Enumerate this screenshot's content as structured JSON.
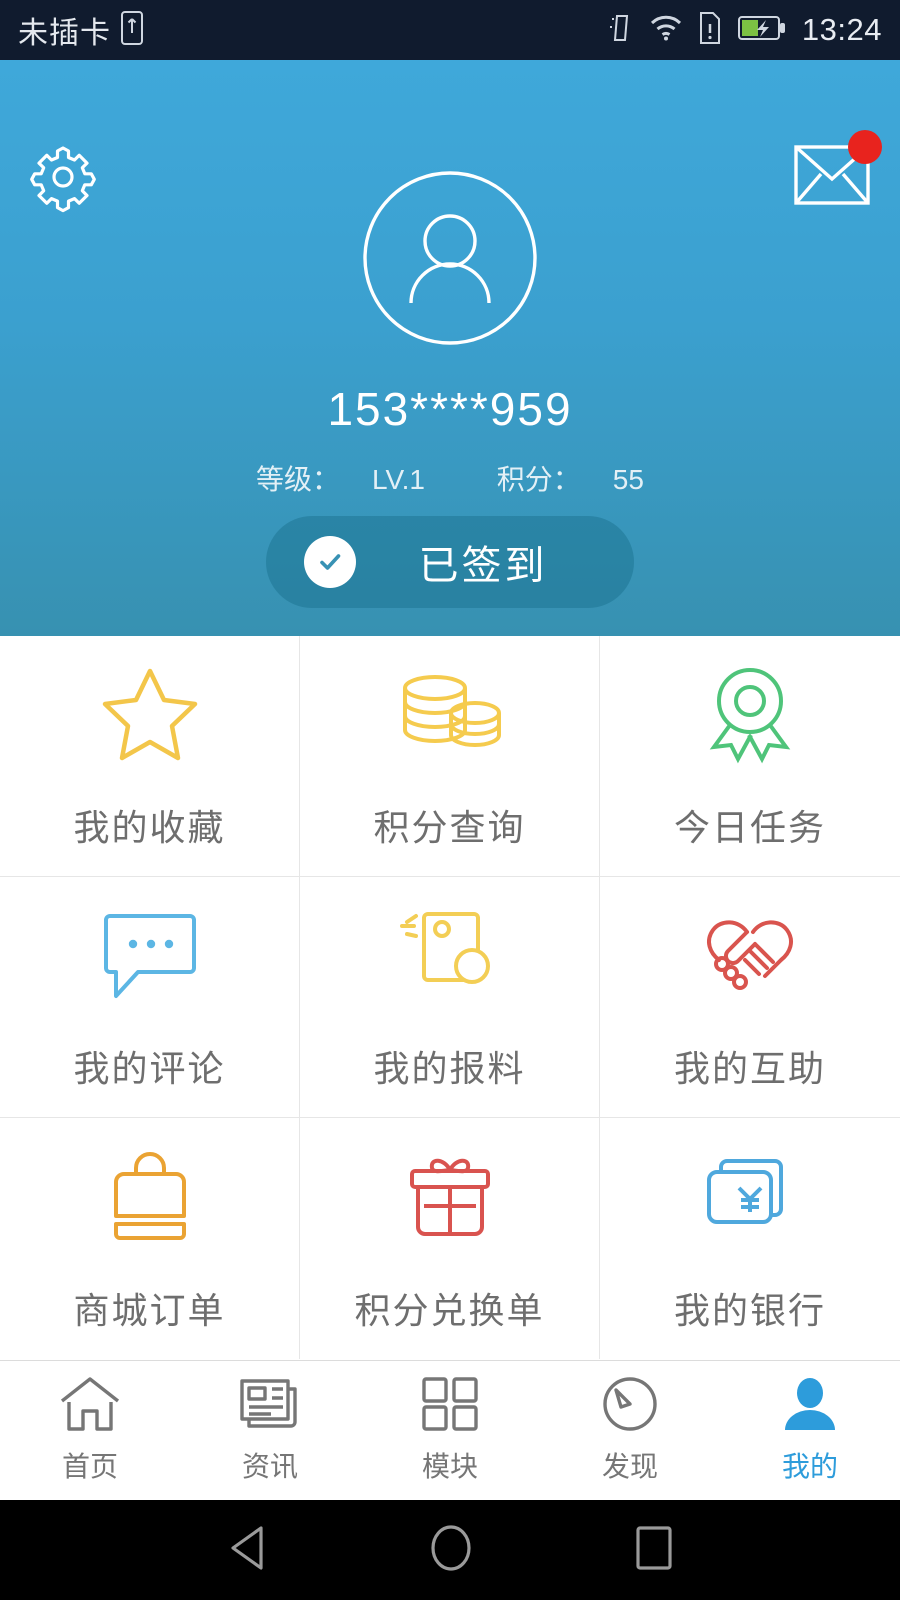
{
  "statusbar": {
    "carrier": "未插卡",
    "time": "13:24",
    "icons": [
      "sim-card-icon",
      "vibrate-icon",
      "wifi-icon",
      "sim-alert-icon",
      "battery-charging-icon"
    ]
  },
  "header": {
    "gear_icon": "gear-icon",
    "mail_icon": "envelope-icon",
    "badge_visible": true,
    "avatar_icon": "user-avatar-icon",
    "username": "153****959",
    "level_label": "等级：",
    "level_value": "LV.1",
    "points_label": "积分：",
    "points_value": "55",
    "signin_label": "已签到",
    "signin_icon": "check-circle-icon",
    "gradient_top": "#3fa8da",
    "gradient_bottom": "#3791b1"
  },
  "grid": {
    "items": [
      {
        "label": "我的收藏",
        "icon": "star-icon",
        "color": "#f3c64a"
      },
      {
        "label": "积分查询",
        "icon": "coins-icon",
        "color": "#f5cb4e"
      },
      {
        "label": "今日任务",
        "icon": "medal-icon",
        "color": "#4fc47a"
      },
      {
        "label": "我的评论",
        "icon": "comment-icon",
        "color": "#5cb6e4"
      },
      {
        "label": "我的报料",
        "icon": "tipoff-icon",
        "color": "#f3ce55"
      },
      {
        "label": "我的互助",
        "icon": "handshake-icon",
        "color": "#d9544e"
      },
      {
        "label": "商城订单",
        "icon": "bag-icon",
        "color": "#eaa333"
      },
      {
        "label": "积分兑换单",
        "icon": "gift-icon",
        "color": "#d9534f"
      },
      {
        "label": "我的银行",
        "icon": "bank-card-icon",
        "color": "#4fa8dd"
      }
    ]
  },
  "tabbar": {
    "active_color": "#2d9cdb",
    "items": [
      {
        "label": "首页",
        "icon": "home-icon",
        "active": false
      },
      {
        "label": "资讯",
        "icon": "news-icon",
        "active": false
      },
      {
        "label": "模块",
        "icon": "modules-icon",
        "active": false
      },
      {
        "label": "发现",
        "icon": "discover-icon",
        "active": false
      },
      {
        "label": "我的",
        "icon": "profile-icon",
        "active": true
      }
    ]
  },
  "navbar": {
    "back_icon": "back-triangle-icon",
    "home_icon": "home-circle-icon",
    "recents_icon": "recents-square-icon"
  }
}
